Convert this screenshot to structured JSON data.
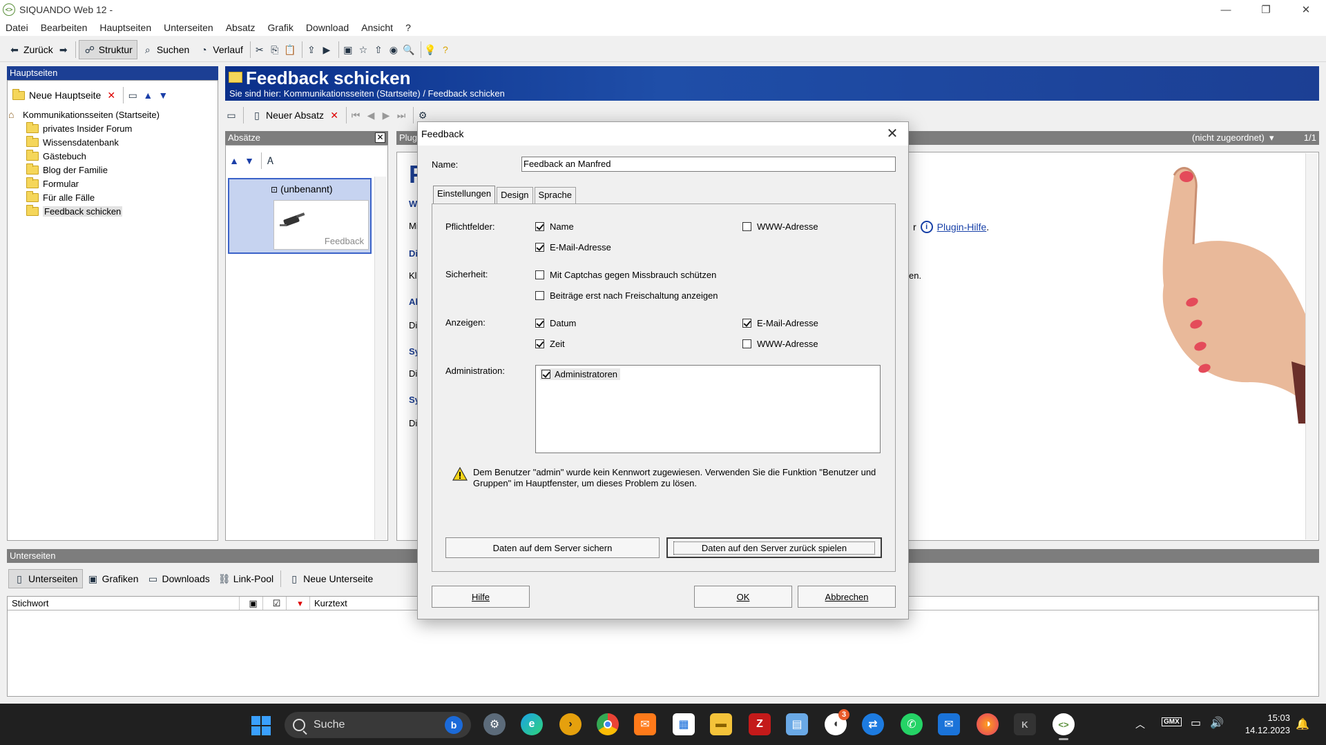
{
  "window": {
    "title": "SIQUANDO Web 12 -",
    "app_icon": "siquando-icon"
  },
  "menu": [
    "Datei",
    "Bearbeiten",
    "Hauptseiten",
    "Unterseiten",
    "Absatz",
    "Grafik",
    "Download",
    "Ansicht",
    "?"
  ],
  "toolbar": {
    "back": "Zurück",
    "structure": "Struktur",
    "search": "Suchen",
    "history": "Verlauf"
  },
  "left": {
    "header": "Hauptseiten",
    "new_main": "Neue Hauptseite",
    "tree_root": "Kommunikationsseiten (Startseite)",
    "tree_children": [
      "privates Insider Forum",
      "Wissensdatenbank",
      "Gästebuch",
      "Blog der Familie",
      "Formular",
      "Für alle Fälle",
      "Feedback schicken"
    ]
  },
  "banner": {
    "title": "Feedback schicken",
    "breadcrumb": "Sie sind hier: Kommunikationsseiten (Startseite) / Feedback schicken"
  },
  "content_toolbar": {
    "new_paragraph": "Neuer Absatz"
  },
  "paragraphs": {
    "header": "Absätze",
    "card_title": "(unbenannt)",
    "card_caption": "Feedback"
  },
  "right": {
    "header": "Plug",
    "assign": "(nicht zugeordnet)",
    "page": "1/1",
    "plugin_help": "Plugin-Hilfe",
    "plugin_help_suffix": ".",
    "text_fragment": "en.",
    "letters": [
      "F",
      "W",
      "Mi",
      "Di",
      "Kl",
      "Al",
      "Di",
      "Sy",
      "Di",
      "Sy",
      "Di"
    ],
    "r_prefix": "r"
  },
  "bottom": {
    "header": "Unterseiten",
    "tabs": [
      "Unterseiten",
      "Grafiken",
      "Downloads",
      "Link-Pool",
      "Neue Unterseite"
    ],
    "col_keyword": "Stichwort",
    "col_short": "Kurztext"
  },
  "dialog": {
    "title": "Feedback",
    "name_label": "Name:",
    "name_value": "Feedback an Manfred",
    "tabs": [
      "Einstellungen",
      "Design",
      "Sprache"
    ],
    "required_label": "Pflichtfelder:",
    "req_name": "Name",
    "req_email": "E-Mail-Adresse",
    "req_www": "WWW-Adresse",
    "security_label": "Sicherheit:",
    "sec_captcha": "Mit Captchas gegen Missbrauch schützen",
    "sec_approve": "Beiträge erst nach Freischaltung anzeigen",
    "display_label": "Anzeigen:",
    "disp_date": "Datum",
    "disp_time": "Zeit",
    "disp_email": "E-Mail-Adresse",
    "disp_www": "WWW-Adresse",
    "admin_label": "Administration:",
    "admin_item": "Administratoren",
    "warning": "Dem Benutzer \"admin\" wurde kein Kennwort zugewiesen. Verwenden Sie die Funktion \"Benutzer und Gruppen\" im Hauptfenster, um dieses Problem zu lösen.",
    "btn_backup": "Daten auf dem Server sichern",
    "btn_restore": "Daten auf den Server zurück spielen",
    "btn_help": "Hilfe",
    "btn_ok": "OK",
    "btn_cancel": "Abbrechen"
  },
  "taskbar": {
    "search": "Suche",
    "badge": "3",
    "time": "15:03",
    "date": "14.12.2023"
  },
  "colors": {
    "accent": "#1c3f94",
    "taskbar": "#202020"
  }
}
